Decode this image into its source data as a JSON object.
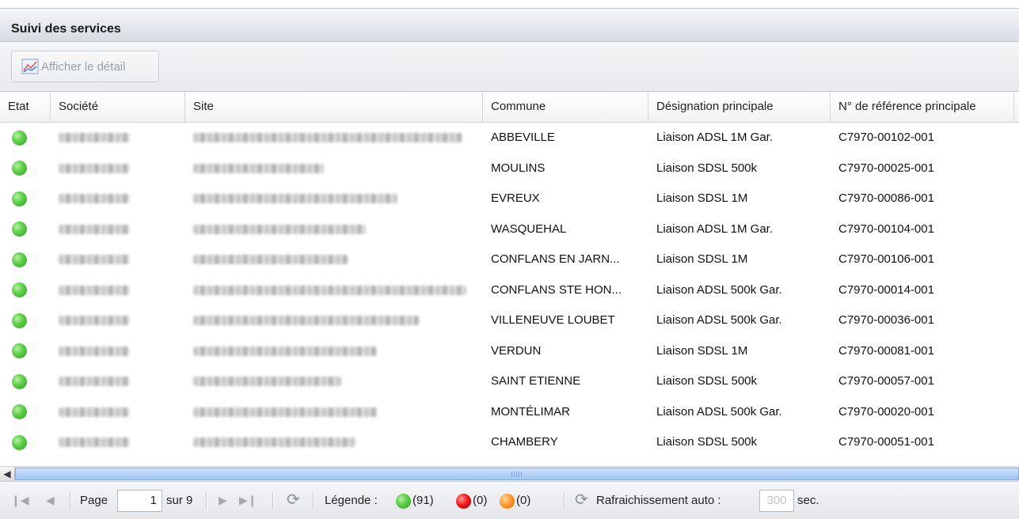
{
  "panel": {
    "title": "Suivi des services"
  },
  "toolbar": {
    "detail_label": "Afficher le détail"
  },
  "columns": [
    "Etat",
    "Société",
    "Site",
    "Commune",
    "Désignation principale",
    "N° de référence principale"
  ],
  "rows": [
    {
      "status": "green",
      "commune": "ABBEVILLE",
      "designation": "Liaison ADSL 1M Gar.",
      "reference": "C7970-00102-001"
    },
    {
      "status": "green",
      "commune": "MOULINS",
      "designation": "Liaison SDSL 500k",
      "reference": "C7970-00025-001"
    },
    {
      "status": "green",
      "commune": "EVREUX",
      "designation": "Liaison SDSL 1M",
      "reference": "C7970-00086-001"
    },
    {
      "status": "green",
      "commune": "WASQUEHAL",
      "designation": "Liaison ADSL 1M Gar.",
      "reference": "C7970-00104-001"
    },
    {
      "status": "green",
      "commune": "CONFLANS EN JARN...",
      "designation": "Liaison SDSL 1M",
      "reference": "C7970-00106-001"
    },
    {
      "status": "green",
      "commune": "CONFLANS STE HON...",
      "designation": "Liaison ADSL 500k Gar.",
      "reference": "C7970-00014-001"
    },
    {
      "status": "green",
      "commune": "VILLENEUVE LOUBET",
      "designation": "Liaison ADSL 500k Gar.",
      "reference": "C7970-00036-001"
    },
    {
      "status": "green",
      "commune": "VERDUN",
      "designation": "Liaison SDSL 1M",
      "reference": "C7970-00081-001"
    },
    {
      "status": "green",
      "commune": "SAINT ETIENNE",
      "designation": "Liaison SDSL 500k",
      "reference": "C7970-00057-001"
    },
    {
      "status": "green",
      "commune": "MONTÉLIMAR",
      "designation": "Liaison ADSL 500k Gar.",
      "reference": "C7970-00020-001"
    },
    {
      "status": "green",
      "commune": "CHAMBERY",
      "designation": "Liaison SDSL 500k",
      "reference": "C7970-00051-001"
    }
  ],
  "pager": {
    "page_label": "Page",
    "page_value": "1",
    "total_label": "sur 9",
    "legend_label": "Légende :",
    "green_count": "(91)",
    "red_count": "(0)",
    "orange_count": "(0)",
    "auto_refresh_label": "Rafraichissement auto :",
    "auto_refresh_value": "300",
    "seconds_label": "sec."
  },
  "colors": {
    "ok": "#3cb834",
    "error": "#e31010",
    "warning": "#ff8c1a",
    "header_bg": "#e4e7ec"
  },
  "icons": [
    "chart-icon",
    "first-page-icon",
    "prev-page-icon",
    "next-page-icon",
    "last-page-icon",
    "refresh-icon"
  ]
}
